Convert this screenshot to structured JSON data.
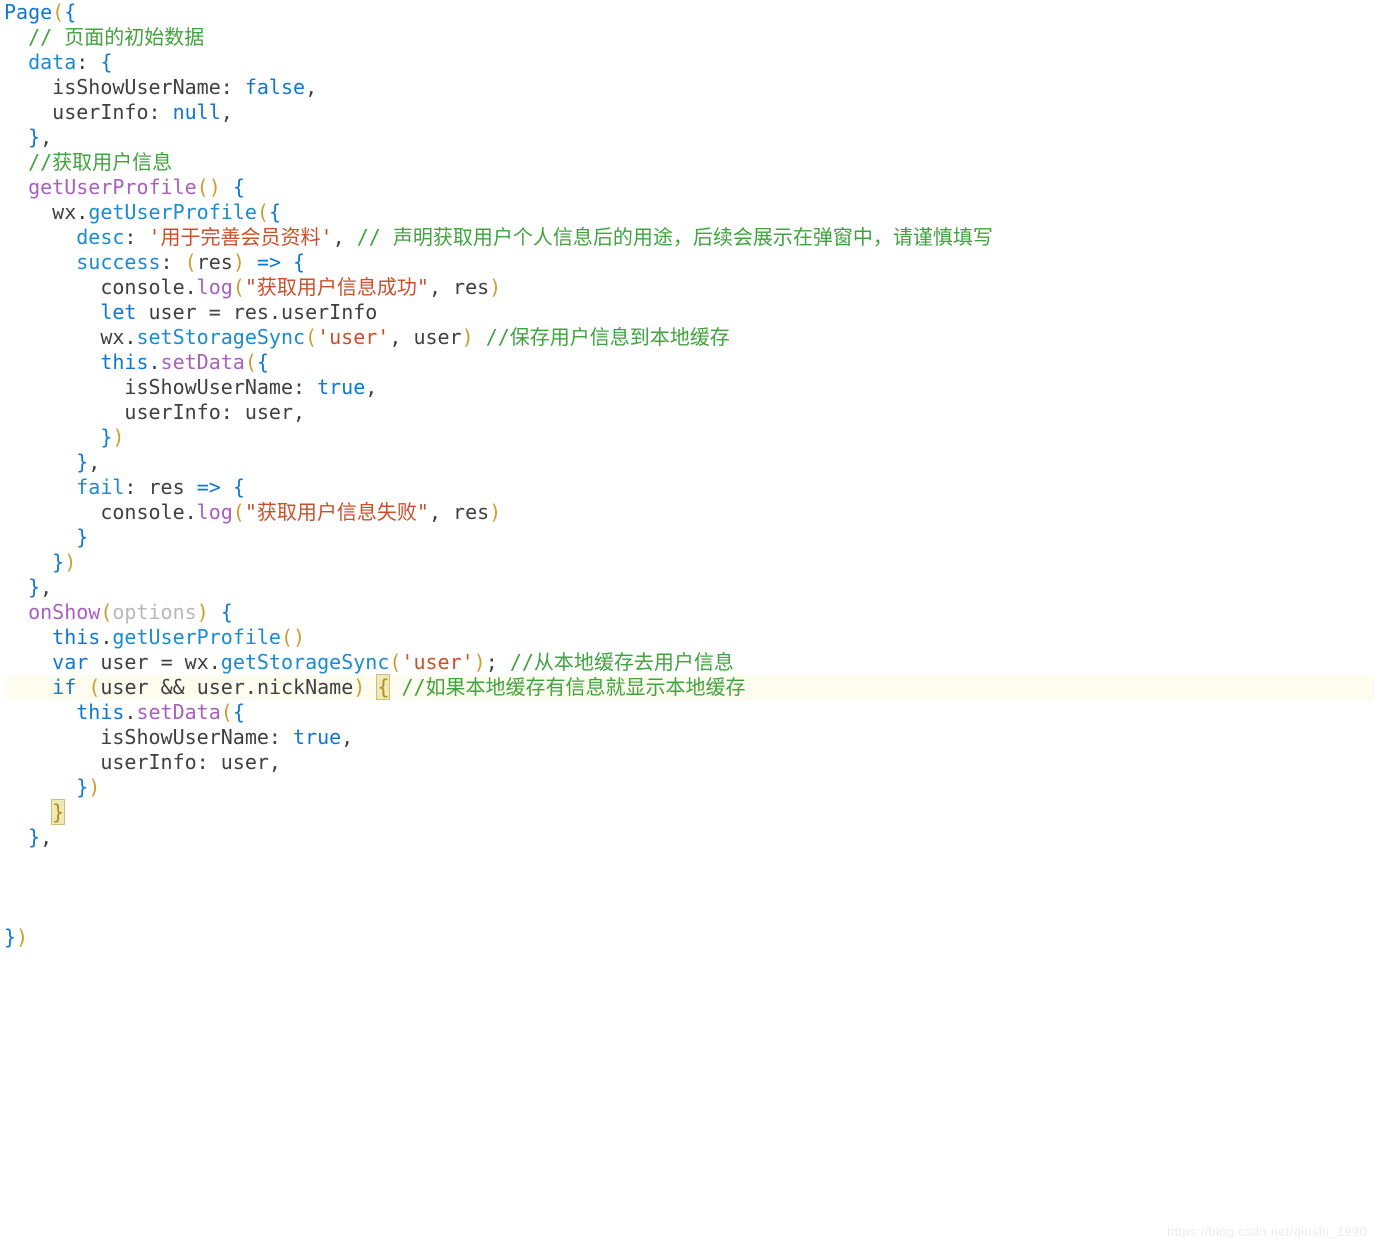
{
  "watermark": "https://blog.csdn.net/qiushi_1990",
  "code": {
    "page_call": "Page",
    "paren_open": "(",
    "paren_close": ")",
    "brace_open": "{",
    "brace_close": "}",
    "comma": ",",
    "colon": ":",
    "dot": ".",
    "semi": ";",
    "arrow": "=>",
    "eq": "=",
    "and": "&&",
    "comment_data_initial": "// 页面的初始数据",
    "prop_data": "data",
    "prop_isShowUserName": "isShowUserName",
    "val_false": "false",
    "prop_userInfo": "userInfo",
    "val_null": "null",
    "comment_get_user_info": "//获取用户信息",
    "fn_getUserProfile": "getUserProfile",
    "ident_wx": "wx",
    "call_getUserProfile": "getUserProfile",
    "prop_desc": "desc",
    "str_desc": "'用于完善会员资料'",
    "comment_desc": "// 声明获取用户个人信息后的用途，后续会展示在弹窗中，请谨慎填写",
    "prop_success": "success",
    "param_res": "res",
    "ident_console": "console",
    "call_log": "log",
    "str_success": "\"获取用户信息成功\"",
    "kw_let": "let",
    "ident_user": "user",
    "ident_res": "res",
    "attr_userInfo": "userInfo",
    "call_setStorageSync": "setStorageSync",
    "str_user_key": "'user'",
    "comment_save_cache": "//保存用户信息到本地缓存",
    "kw_this": "this",
    "call_setData": "setData",
    "val_true": "true",
    "prop_fail": "fail",
    "str_fail": "\"获取用户信息失败\"",
    "fn_onShow": "onShow",
    "param_options": "options",
    "call_getUserProfile_this": "getUserProfile",
    "kw_var": "var",
    "call_getStorageSync": "getStorageSync",
    "comment_get_cache": "//从本地缓存去用户信息",
    "kw_if": "if",
    "attr_nickName": "nickName",
    "comment_if_cache": "//如果本地缓存有信息就显示本地缓存"
  }
}
